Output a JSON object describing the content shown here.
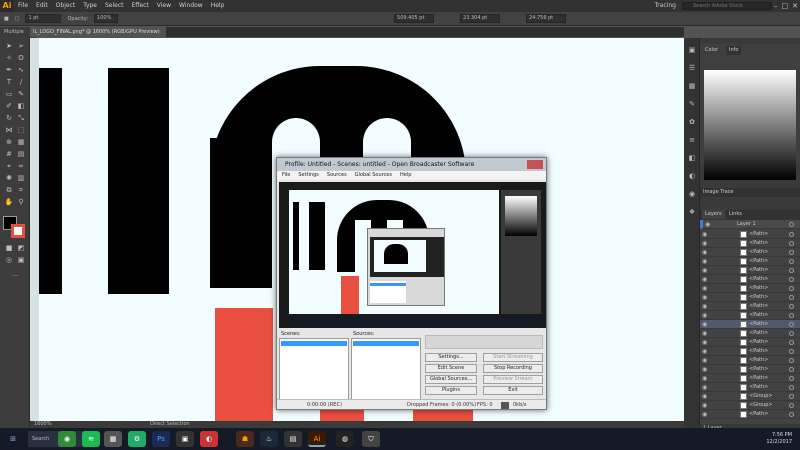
{
  "menubar": {
    "logo": "Ai",
    "items": [
      "File",
      "Edit",
      "Object",
      "Type",
      "Select",
      "Effect",
      "View",
      "Window",
      "Help"
    ],
    "workspace": "Tracing",
    "stock_search_placeholder": "Search Adobe Stock"
  },
  "controlbar": {
    "stroke_value": "1 pt",
    "opacity_label": "Opacity:",
    "opacity_value": "100%",
    "x_value": "509.405 pt",
    "y_value": "23.304 pt",
    "w_value": "24.756 pt"
  },
  "ctrl2_label": "Multiple Paths",
  "document_tab": "IL_LOGO_FINAL.png* @ 1600% (RGB/GPU Preview)",
  "obs": {
    "title": "Profile: Untitled - Scenes: untitled - Open Broadcaster Software",
    "menus": [
      "File",
      "Settings",
      "Sources",
      "Global Sources",
      "Help"
    ],
    "scenes_header": "Scenes:",
    "sources_header": "Sources:",
    "buttons": {
      "settings": "Settings...",
      "edit_scene": "Edit Scene",
      "global_sources": "Global Sources...",
      "plugins": "Plugins",
      "start_streaming": "Start Streaming",
      "stop_recording": "Stop Recording",
      "preview_stream": "Preview Stream",
      "exit": "Exit"
    },
    "status": {
      "time": "0:00:00 (REC)",
      "dropped": "Dropped Frames: 0 (0.00%)",
      "fps": "FPS: 0",
      "kbps": "0kb/s"
    }
  },
  "right_panel": {
    "color_tabs": [
      "Color",
      "Info"
    ],
    "image_trace_title": "Image Trace",
    "layers_tabs": [
      "Layers",
      "Links"
    ],
    "layer_top": "Layer 1",
    "layer_items": [
      "<Path>",
      "<Path>",
      "<Path>",
      "<Path>",
      "<Path>",
      "<Path>",
      "<Path>",
      "<Path>",
      "<Path>",
      "<Path>",
      "<Path>",
      "<Path>",
      "<Path>",
      "<Path>",
      "<Path>",
      "<Path>",
      "<Path>",
      "<Path>",
      "<Group>",
      "<Group>",
      "<Path>"
    ],
    "footer": "1 Layer"
  },
  "statusbar": {
    "zoom": "1600%",
    "tool": "Direct Selection"
  },
  "taskbar": {
    "search_label": "Search",
    "time": "7:56 PM",
    "date": "12/2/2017"
  },
  "colors": {
    "illustrator_orange": "#ff9a00",
    "logo_red": "#e94f3f",
    "selection_blue": "#3399ff"
  }
}
